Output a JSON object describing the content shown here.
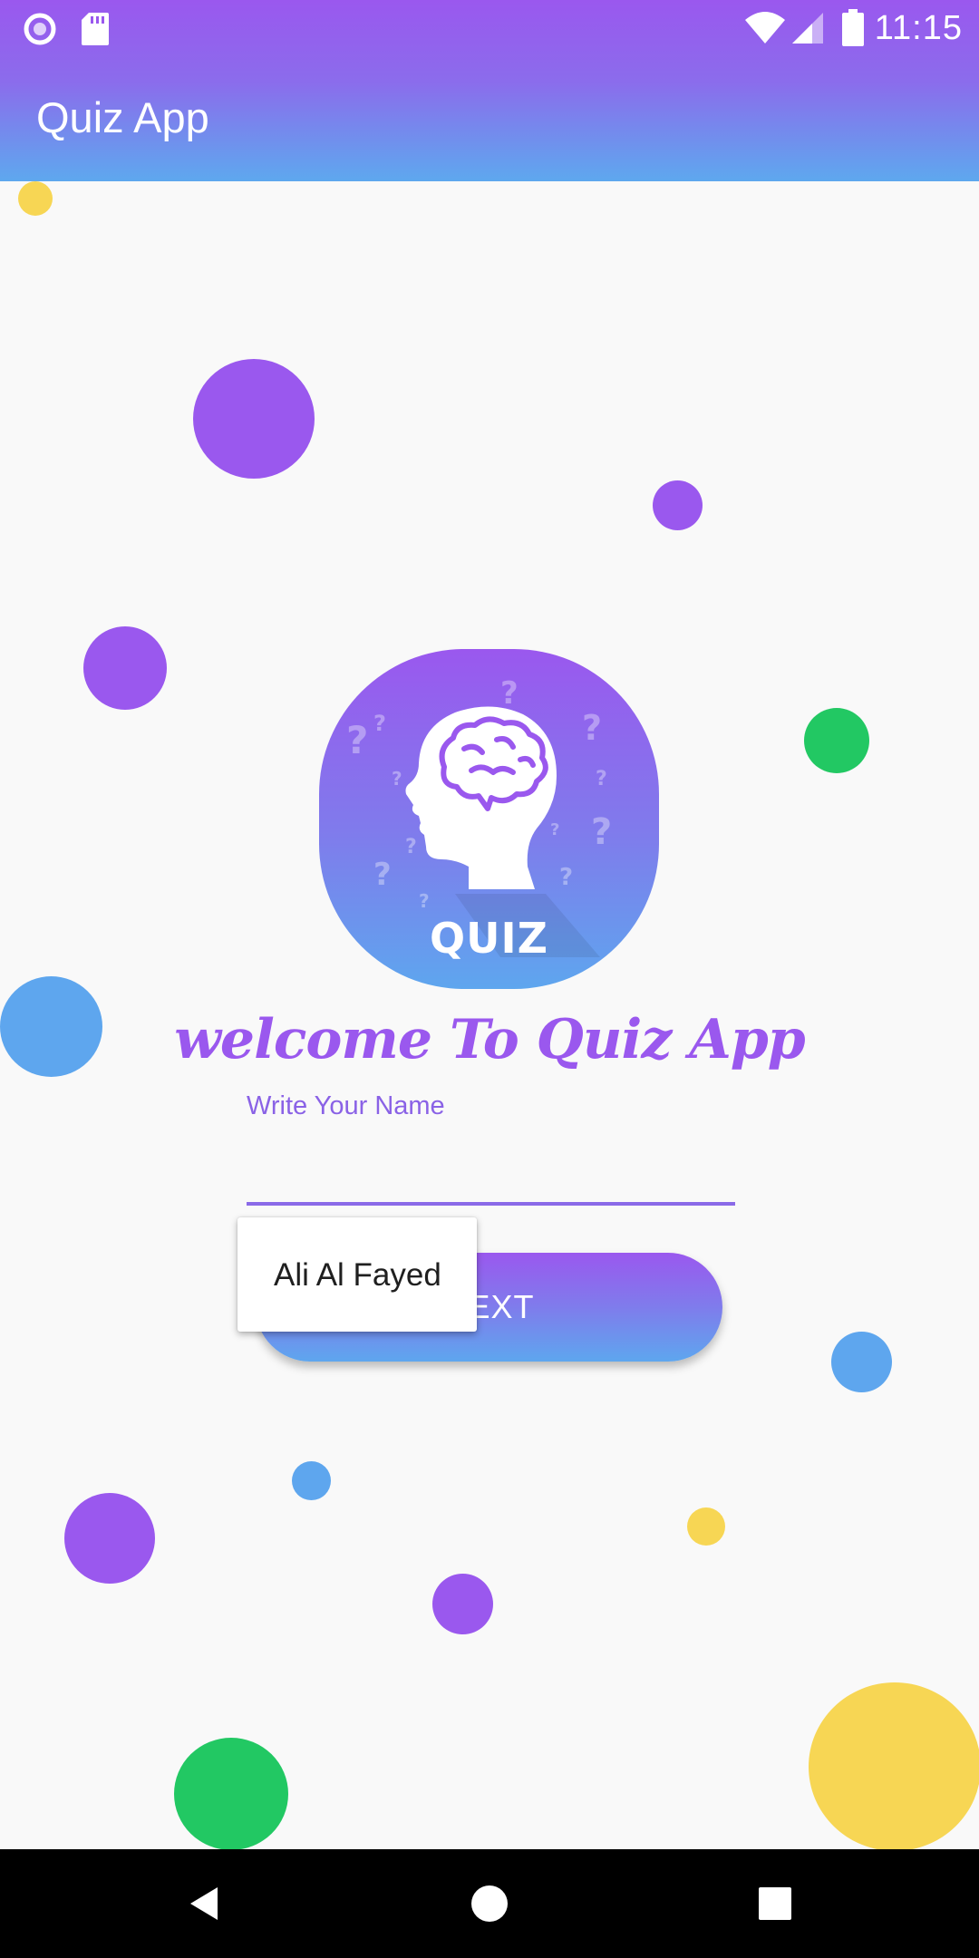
{
  "status_bar": {
    "time": "11:15",
    "left_icons": [
      "record-icon",
      "sd-card-icon"
    ],
    "right_icons": [
      "wifi-icon",
      "signal-icon",
      "battery-icon"
    ]
  },
  "app_bar": {
    "title": "Quiz App"
  },
  "logo": {
    "text": "QUIZ",
    "icon": "brain-head-icon"
  },
  "welcome_text": "welcome To Quiz App",
  "name_field": {
    "label": "Write Your Name",
    "value": ""
  },
  "next_button": {
    "label": "NEXT"
  },
  "autocomplete": {
    "items": [
      "Ali Al Fayed"
    ]
  },
  "nav_bar": {
    "buttons": [
      "back-icon",
      "home-icon",
      "recents-icon"
    ]
  },
  "colors": {
    "purple": "#9a58ee",
    "blue": "#5ea6ee",
    "green": "#22c863",
    "yellow": "#f7d654",
    "background": "#f9f9f9"
  }
}
